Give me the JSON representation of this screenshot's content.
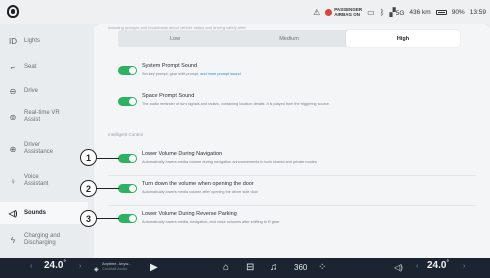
{
  "status_bar": {
    "airbag_line1": "PASSENGER",
    "airbag_line2": "AIRBAG ON",
    "signal_label": "5G",
    "range": "436 km",
    "battery": "90%",
    "clock": "13:59"
  },
  "sidebar": {
    "items": [
      {
        "label": "Lights",
        "icon": "lights-icon",
        "glyph": "☼"
      },
      {
        "label": "Seat",
        "icon": "seat-icon",
        "glyph": "⌐"
      },
      {
        "label": "Drive",
        "icon": "steering-wheel-icon",
        "glyph": "⊖"
      },
      {
        "label": "Real-time VR Assist",
        "icon": "vr-assist-icon",
        "glyph": "⊚"
      },
      {
        "label": "Driver Assistance",
        "icon": "driver-assistance-icon",
        "glyph": "⊕"
      },
      {
        "label": "Voice Assistant",
        "icon": "voice-assistant-icon",
        "glyph": "♀"
      },
      {
        "label": "Sounds",
        "icon": "speaker-icon",
        "glyph": "◁)"
      },
      {
        "label": "Charging and Discharging",
        "icon": "charging-icon",
        "glyph": "ϟ"
      }
    ],
    "active_index": 6
  },
  "main": {
    "top_note": "including prompts and broadcasts about vehicle status and driving safety alert",
    "volume_levels": [
      "Low",
      "Medium",
      "High"
    ],
    "selected_level": "High",
    "system_prompt": {
      "title": "System Prompt Sound",
      "desc": "Set key prompt, gear shift prompt,",
      "link": "and more prompt sound",
      "enabled": true
    },
    "space_prompt": {
      "title": "Space Prompt Sound",
      "desc": "The audio reminder of turn signals and radars, containing location details. It is played from the triggering source.",
      "enabled": true
    },
    "section_label": "Intelligent Control",
    "intelligent": [
      {
        "callout": "1",
        "title": "Lower Volume During Navigation",
        "desc": "Automatically lowers media volume during navigation announcements in both shared and private modes",
        "enabled": true
      },
      {
        "callout": "2",
        "title": "Turn down the volume when opening the door",
        "desc": "Automatically lowers media volume after opening the driver side door",
        "enabled": true
      },
      {
        "callout": "3",
        "title": "Lower Volume During Reverse Parking",
        "desc": "Automatically lowers media, navigation, and voice volumes after shifting to R gear",
        "enabled": true
      }
    ]
  },
  "dock": {
    "left_temp": "24.0",
    "right_temp": "24.0",
    "deg": "°",
    "media_title": "Anytime, Anyw...",
    "media_sub": "Cocktail Audio",
    "center_label": "360"
  },
  "colors": {
    "toggle_on": "#2cb361",
    "dock_bg": "#1c2431",
    "link": "#2f7cd8"
  }
}
